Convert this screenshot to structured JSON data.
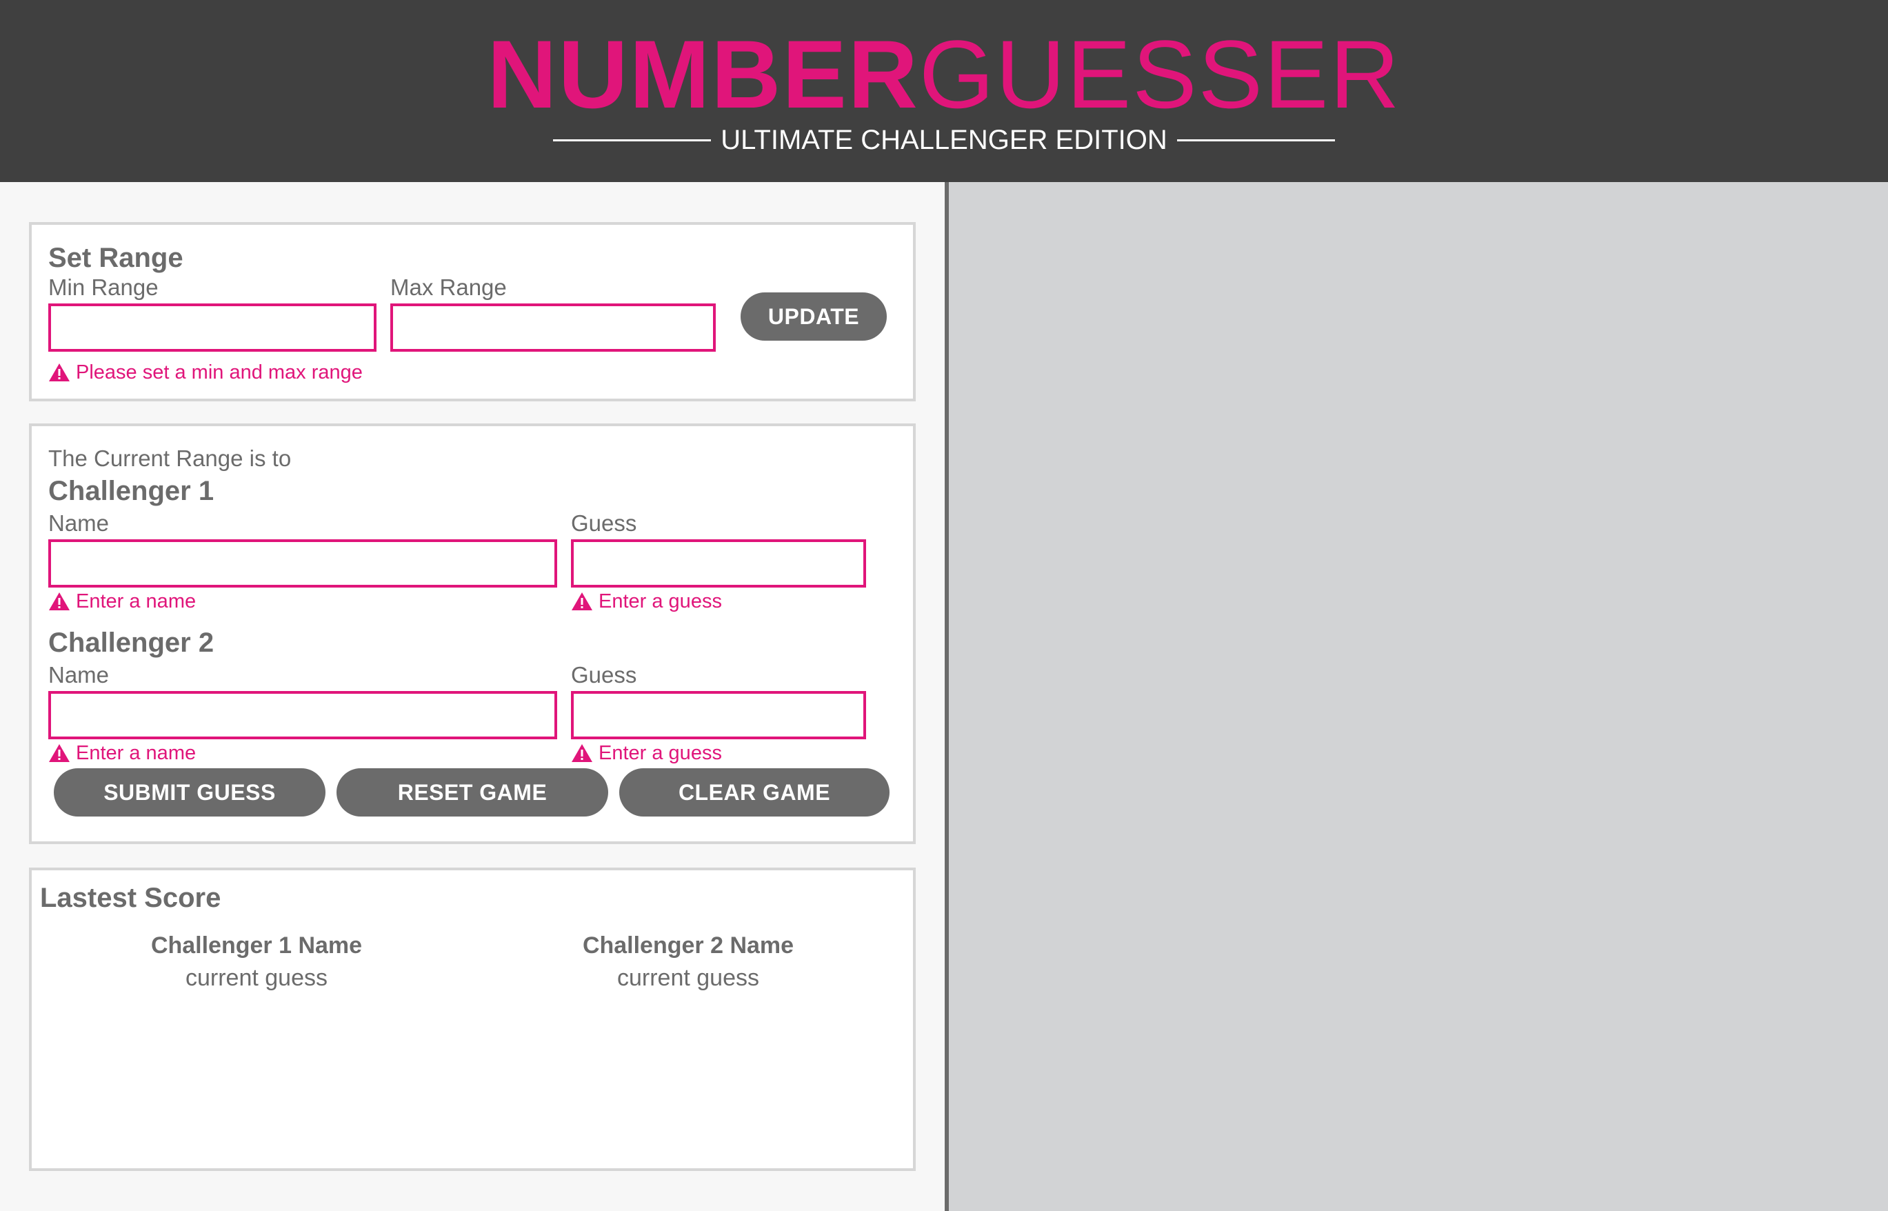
{
  "header": {
    "title_bold": "NUMBER",
    "title_light": "GUESSER",
    "subtitle": "ULTIMATE CHALLENGER EDITION"
  },
  "colors": {
    "accent": "#e0157a",
    "header_bg": "#404040",
    "button_bg": "#6b6b6b",
    "right_panel_bg": "#d2d3d5"
  },
  "range": {
    "title": "Set Range",
    "min_label": "Min Range",
    "min_value": "",
    "max_label": "Max Range",
    "max_value": "",
    "update_label": "UPDATE",
    "error": "Please set a min and max range",
    "error_icon": "warning-icon"
  },
  "game": {
    "current_range_text": "The Current Range is to",
    "challenger1": {
      "title": "Challenger 1",
      "name_label": "Name",
      "name_value": "",
      "guess_label": "Guess",
      "guess_value": "",
      "name_error": "Enter a name",
      "guess_error": "Enter a guess"
    },
    "challenger2": {
      "title": "Challenger 2",
      "name_label": "Name",
      "name_value": "",
      "guess_label": "Guess",
      "guess_value": "",
      "name_error": "Enter a name",
      "guess_error": "Enter a guess"
    },
    "submit_label": "SUBMIT GUESS",
    "reset_label": "RESET GAME",
    "clear_label": "CLEAR GAME"
  },
  "score": {
    "title": "Lastest Score",
    "c1_name": "Challenger 1 Name",
    "c1_guess": "current guess",
    "c2_name": "Challenger 2 Name",
    "c2_guess": "current guess"
  }
}
